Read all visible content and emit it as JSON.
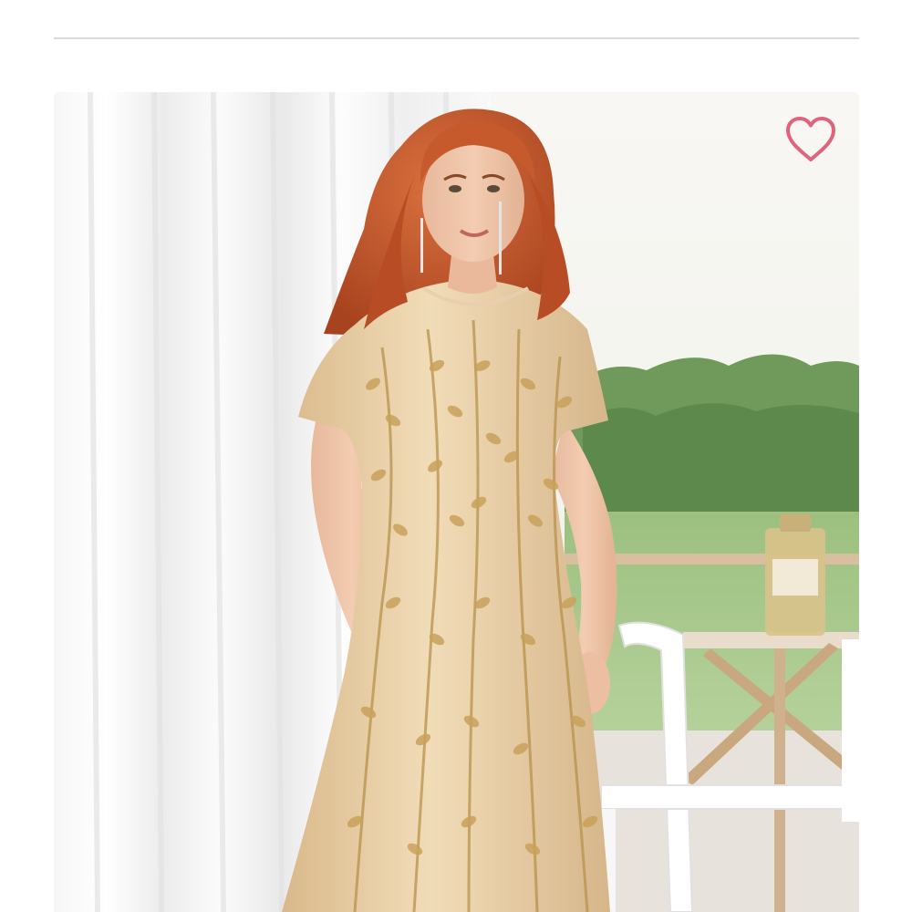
{
  "product": {
    "image_alt": "",
    "wishlist_icon": "heart-outline-icon",
    "wishlist_color": "#e0637e",
    "wishlist_active": false
  },
  "colors": {
    "divider": "#d9d9d9",
    "background": "#ffffff",
    "dress": "#e8cfa6",
    "hair": "#c8562c"
  }
}
